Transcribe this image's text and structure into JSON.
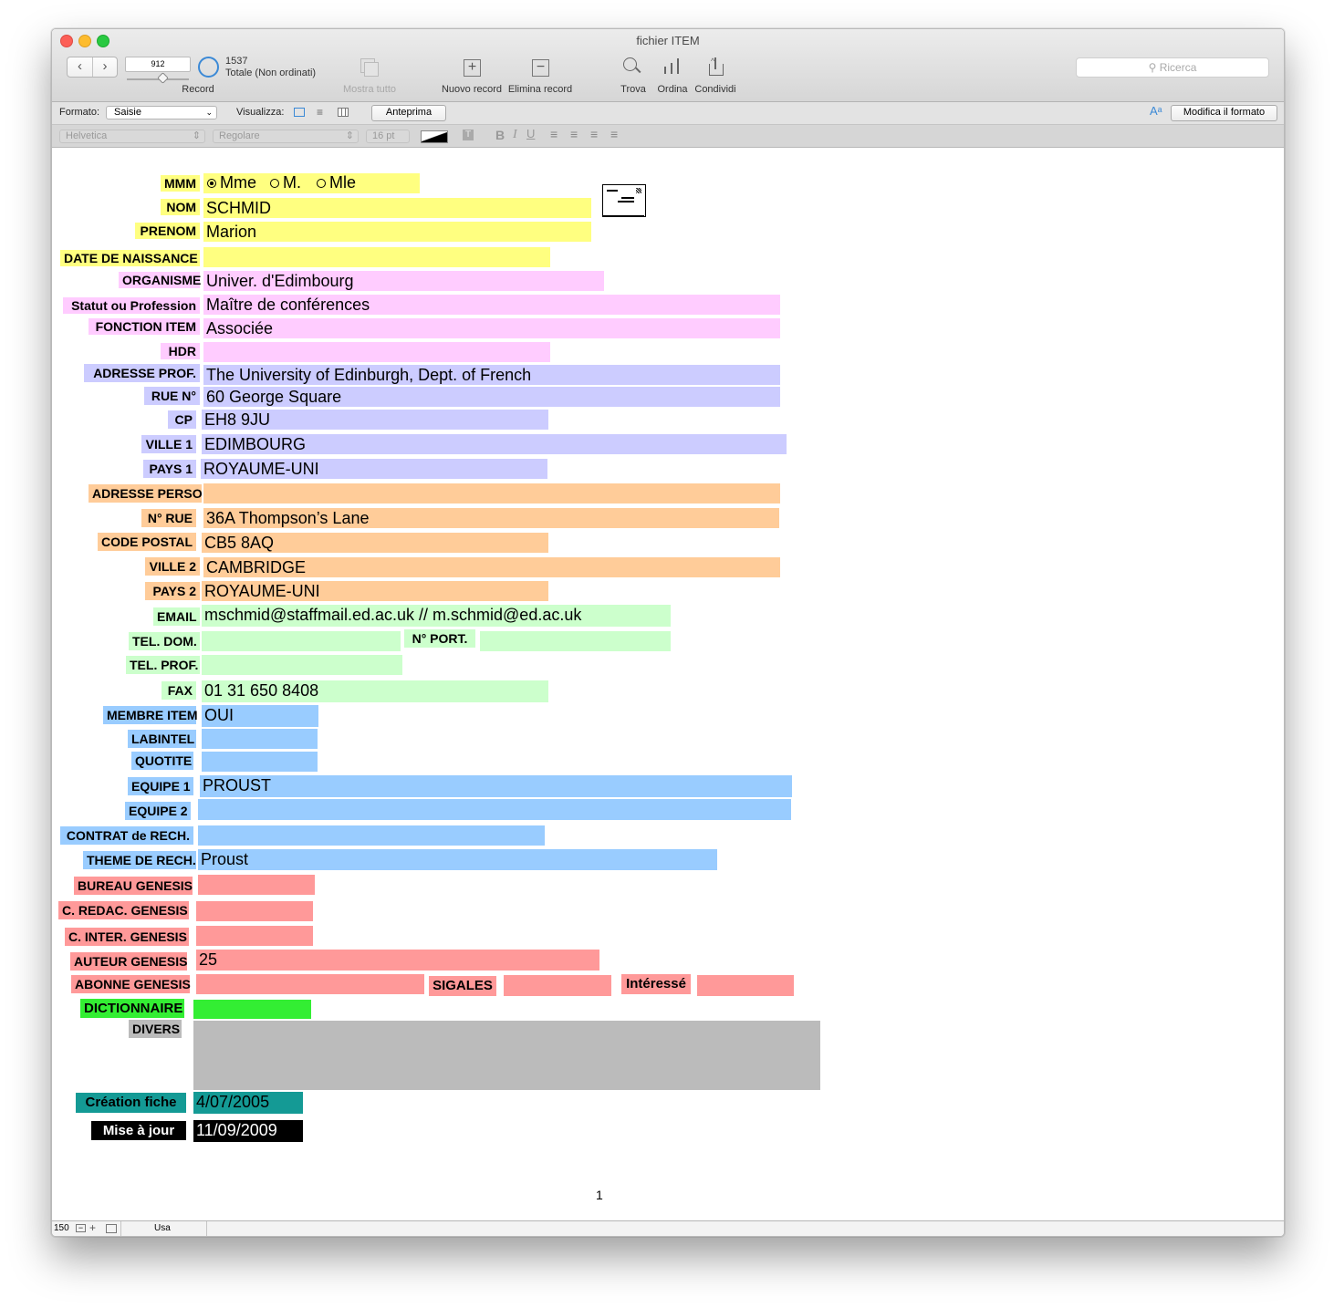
{
  "window": {
    "title": "fichier ITEM"
  },
  "toolbar": {
    "record_number": "912",
    "record_total": "1537",
    "record_total_desc": "Totale (Non ordinati)",
    "record_label": "Record",
    "show_all": "Mostra tutto",
    "new_record": "Nuovo record",
    "delete_record": "Elimina record",
    "find": "Trova",
    "sort": "Ordina",
    "share": "Condividi",
    "search_placeholder": "Ricerca"
  },
  "layout_bar": {
    "format_label": "Formato:",
    "format_value": "Saisie",
    "view_label": "Visualizza:",
    "preview_button": "Anteprima",
    "modify_format_button": "Modifica il formato"
  },
  "format_bar": {
    "font": "Helvetica",
    "style": "Regolare",
    "size": "16 pt"
  },
  "form": {
    "mmm": {
      "label": "MMM",
      "options": [
        "Mme",
        "M.",
        "Mle"
      ],
      "selected": "Mme"
    },
    "nom": {
      "label": "NOM",
      "value": "SCHMID"
    },
    "prenom": {
      "label": "PRENOM",
      "value": "Marion"
    },
    "date_naissance": {
      "label": "DATE DE NAISSANCE",
      "value": ""
    },
    "organisme": {
      "label": "ORGANISME",
      "value": "Univer. d'Edimbourg"
    },
    "statut": {
      "label": "Statut ou Profession",
      "value": "Maître de conférences"
    },
    "fonction": {
      "label": "FONCTION ITEM",
      "value": "Associée"
    },
    "hdr": {
      "label": "HDR",
      "value": ""
    },
    "adresse_prof": {
      "label": "ADRESSE PROF.",
      "value": "The University of Edinburgh, Dept. of French"
    },
    "rue": {
      "label": "RUE N°",
      "value": "60 George Square"
    },
    "cp": {
      "label": "CP",
      "value": "EH8 9JU"
    },
    "ville1": {
      "label": "VILLE 1",
      "value": "EDIMBOURG"
    },
    "pays1": {
      "label": "PAYS 1",
      "value": "ROYAUME-UNI"
    },
    "adresse_perso": {
      "label": "ADRESSE PERSO",
      "value": ""
    },
    "n_rue": {
      "label": "N° RUE",
      "value": "36A Thompson’s Lane"
    },
    "code_postal": {
      "label": "CODE POSTAL",
      "value": "CB5 8AQ"
    },
    "ville2": {
      "label": "VILLE 2",
      "value": "CAMBRIDGE"
    },
    "pays2": {
      "label": "PAYS 2",
      "value": "ROYAUME-UNI"
    },
    "email": {
      "label": "EMAIL",
      "value": "mschmid@staffmail.ed.ac.uk // m.schmid@ed.ac.uk"
    },
    "tel_dom": {
      "label": "TEL. DOM.",
      "value": ""
    },
    "n_port": {
      "label": "N° PORT.",
      "value": ""
    },
    "tel_prof": {
      "label": "TEL. PROF.",
      "value": ""
    },
    "fax": {
      "label": "FAX",
      "value": "01 31 650 8408"
    },
    "membre": {
      "label": "MEMBRE ITEM",
      "value": "OUI"
    },
    "labintel": {
      "label": "LABINTEL",
      "value": ""
    },
    "quotite": {
      "label": "QUOTITE",
      "value": ""
    },
    "equipe1": {
      "label": "EQUIPE 1",
      "value": "PROUST"
    },
    "equipe2": {
      "label": "EQUIPE 2",
      "value": ""
    },
    "contrat": {
      "label": "CONTRAT de RECH.",
      "value": ""
    },
    "theme": {
      "label": "THEME DE RECH.",
      "value": "Proust"
    },
    "bureau": {
      "label": "BUREAU GENESIS",
      "value": ""
    },
    "c_redac": {
      "label": "C. REDAC. GENESIS",
      "value": ""
    },
    "c_inter": {
      "label": "C. INTER. GENESIS",
      "value": ""
    },
    "auteur": {
      "label": "AUTEUR GENESIS",
      "value": "25"
    },
    "abonne": {
      "label": "ABONNE GENESIS",
      "value": ""
    },
    "sigales": {
      "label": "SIGALES",
      "value": ""
    },
    "interesse": {
      "label": "Intéressé",
      "value": ""
    },
    "dictionnaire": {
      "label": "DICTIONNAIRE",
      "value": ""
    },
    "divers": {
      "label": "DIVERS",
      "value": ""
    },
    "creation": {
      "label": "Création fiche",
      "value": "4/07/2005"
    },
    "mise_a_jour": {
      "label": "Mise à jour",
      "value": "11/09/2009"
    }
  },
  "page_number": "1",
  "status": {
    "zoom": "150",
    "mode": "Usa"
  },
  "colors": {
    "identity": "#ffff80",
    "profession": "#ffccff",
    "address_prof": "#ccccff",
    "address_perso": "#ffcc99",
    "contact": "#ccffcc",
    "membership": "#99ccff",
    "genesis": "#ff9999",
    "dictionnaire": "#33ee33",
    "divers": "#bbbbbb",
    "creation": "#149a95",
    "mise_a_jour": "#000000"
  }
}
